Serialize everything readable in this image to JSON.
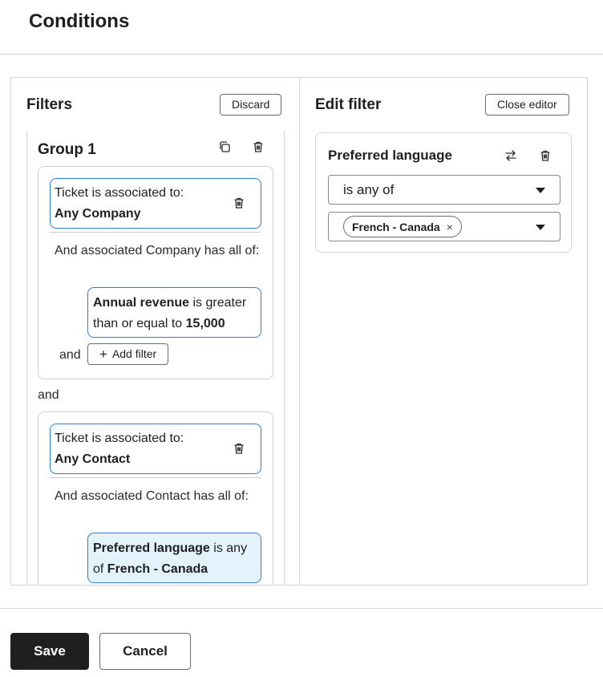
{
  "header": {
    "title": "Conditions"
  },
  "filters": {
    "title": "Filters",
    "discard_label": "Discard",
    "group": {
      "title": "Group 1",
      "copy_icon": "copy-icon",
      "delete_icon": "trash-icon",
      "blocks": [
        {
          "assoc_line1": "Ticket is associated to:",
          "assoc_line2": "Any Company",
          "has_all_text": "And associated Company has all of:",
          "rule_prop": "Annual revenue",
          "rule_mid": "is greater than or equal to",
          "rule_value": "15,000",
          "and_label": "and",
          "add_filter_label": "Add filter"
        },
        {
          "assoc_line1": "Ticket is associated to:",
          "assoc_line2": "Any Contact",
          "has_all_text": "And associated Contact has all of:",
          "rule_prop": "Preferred language",
          "rule_mid": "is any of",
          "rule_value": "French - Canada"
        }
      ],
      "between_and": "and"
    }
  },
  "editor": {
    "title": "Edit filter",
    "close_label": "Close editor",
    "property": "Preferred language",
    "swap_icon": "swap-arrows-icon",
    "delete_icon": "trash-icon",
    "operator": "is any of",
    "selected_values": [
      "French - Canada"
    ],
    "remove_tag_glyph": "×"
  },
  "footer": {
    "save_label": "Save",
    "cancel_label": "Cancel"
  },
  "colors": {
    "accent_border": "#2b7ce0",
    "active_rule_bg": "#e3f3fb",
    "primary_button": "#1f1f1f"
  }
}
